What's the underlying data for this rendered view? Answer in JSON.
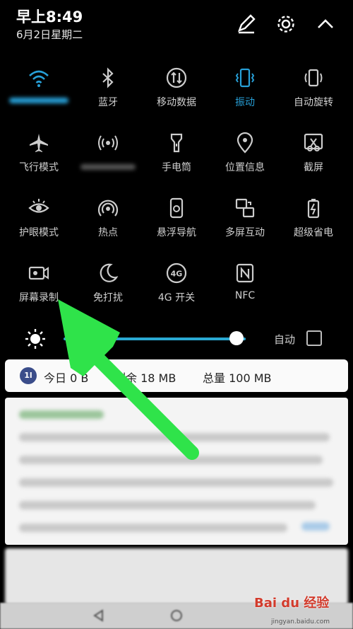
{
  "status": {
    "time": "早上8:49",
    "date": "6月2日星期二"
  },
  "tiles": [
    {
      "label": "",
      "icon": "wifi-icon",
      "active": true
    },
    {
      "label": "蓝牙",
      "icon": "bluetooth-icon",
      "active": false
    },
    {
      "label": "移动数据",
      "icon": "mobile-data-icon",
      "active": false
    },
    {
      "label": "振动",
      "icon": "vibrate-icon",
      "active": true
    },
    {
      "label": "自动旋转",
      "icon": "auto-rotate-icon",
      "active": false
    },
    {
      "label": "飞行模式",
      "icon": "airplane-icon",
      "active": false
    },
    {
      "label": "",
      "icon": "hotspot-signal-icon",
      "active": false
    },
    {
      "label": "手电筒",
      "icon": "flashlight-icon",
      "active": false
    },
    {
      "label": "位置信息",
      "icon": "location-icon",
      "active": false
    },
    {
      "label": "截屏",
      "icon": "screenshot-icon",
      "active": false
    },
    {
      "label": "护眼模式",
      "icon": "eye-comfort-icon",
      "active": false
    },
    {
      "label": "热点",
      "icon": "hotspot-icon",
      "active": false
    },
    {
      "label": "悬浮导航",
      "icon": "floating-nav-icon",
      "active": false
    },
    {
      "label": "多屏互动",
      "icon": "multi-screen-icon",
      "active": false
    },
    {
      "label": "超级省电",
      "icon": "battery-saver-icon",
      "active": false
    },
    {
      "label": "屏幕录制",
      "icon": "screen-record-icon",
      "active": false
    },
    {
      "label": "免打扰",
      "icon": "do-not-disturb-icon",
      "active": false
    },
    {
      "label": "4G 开关",
      "icon": "4g-icon",
      "active": false
    },
    {
      "label": "NFC",
      "icon": "nfc-icon",
      "active": false
    }
  ],
  "brightness": {
    "level": 0.95,
    "auto_label": "自动",
    "auto_checked": false
  },
  "data_usage": {
    "icon_text": "1l",
    "today": "今日 0 B",
    "remaining": "剩余 18 MB",
    "total": "总量 100 MB"
  },
  "watermark": {
    "text": "Bai du 经验",
    "sub": "jingyan.baidu.com"
  },
  "colors": {
    "accent": "#27a0d8",
    "arrow": "#2fe34a",
    "panel_bg": "#000000"
  }
}
